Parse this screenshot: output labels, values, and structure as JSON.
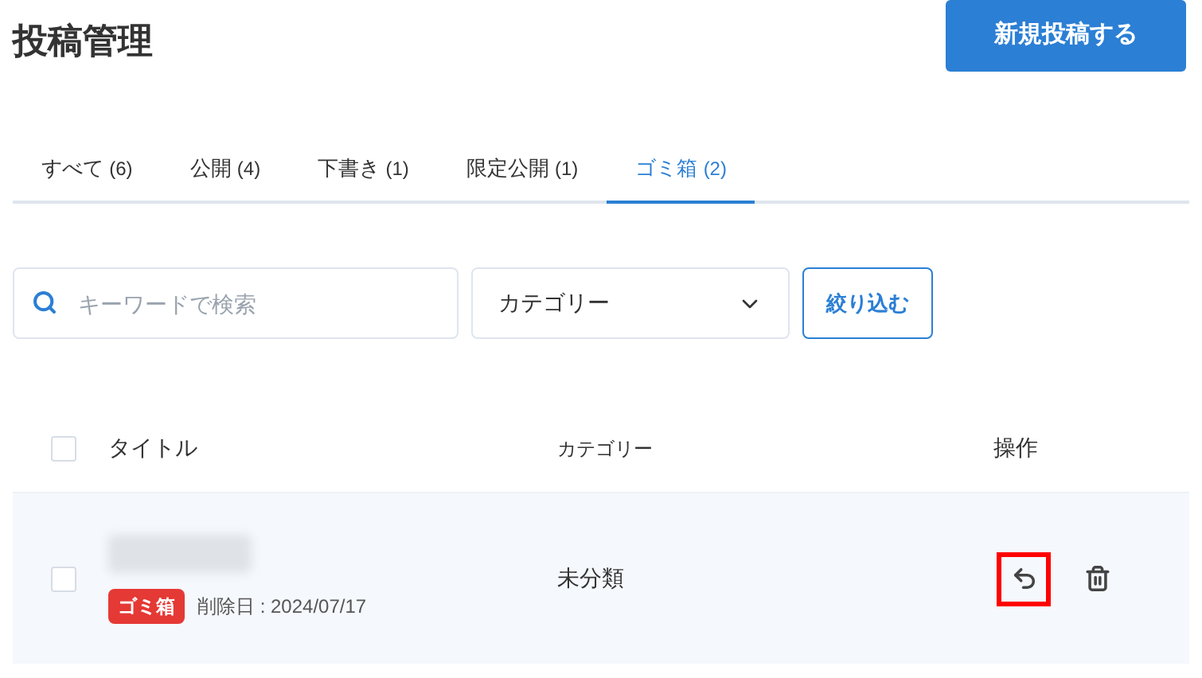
{
  "page_title": "投稿管理",
  "new_post_button": "新規投稿する",
  "tabs": [
    {
      "label": "すべて",
      "count": "(6)",
      "selected": false
    },
    {
      "label": "公開",
      "count": "(4)",
      "selected": false
    },
    {
      "label": "下書き",
      "count": "(1)",
      "selected": false
    },
    {
      "label": "限定公開",
      "count": "(1)",
      "selected": false
    },
    {
      "label": "ゴミ箱",
      "count": "(2)",
      "selected": true
    }
  ],
  "search": {
    "placeholder": "キーワードで検索"
  },
  "category_select": {
    "value": "カテゴリー"
  },
  "filter_button": "絞り込む",
  "table": {
    "columns": [
      "タイトル",
      "カテゴリー",
      "操作"
    ],
    "header_checked": false,
    "rows": [
      {
        "checked": false,
        "title_blurred": true,
        "badge": "ゴミ箱",
        "deleted_date": "削除日 : 2024/07/17",
        "category": "未分類",
        "actions": [
          {
            "kind": "restore",
            "highlighted": true
          },
          {
            "kind": "delete",
            "highlighted": false
          }
        ]
      }
    ]
  }
}
